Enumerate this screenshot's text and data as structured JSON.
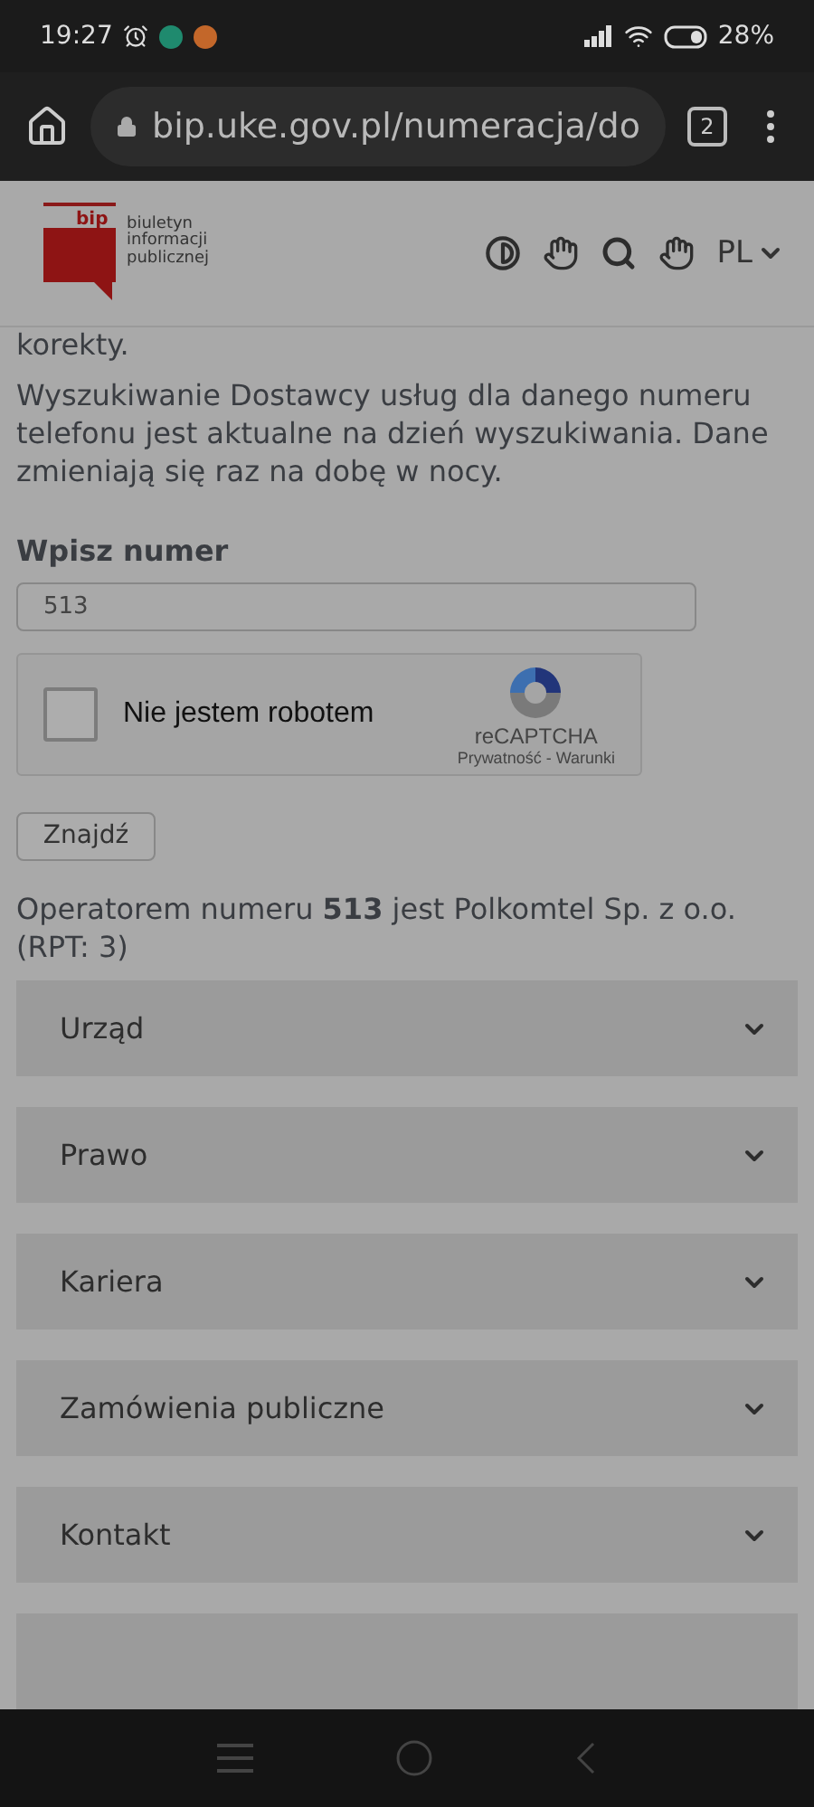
{
  "status_bar": {
    "time": "19:27",
    "battery": "28%"
  },
  "browser": {
    "url": "bip.uke.gov.pl/numeracja/do",
    "tab_count": "2"
  },
  "header": {
    "logo_text": "biuletyn informacji publicznej",
    "logo_mark": "bip",
    "language": "PL"
  },
  "content": {
    "cut_text": "korekty.",
    "intro": "Wyszukiwanie Dostawcy usług dla danego numeru telefonu jest aktualne na dzień wyszukiwania. Dane zmieniają się raz na dobę w nocy.",
    "field_label": "Wpisz numer",
    "field_value": "513",
    "captcha": {
      "label": "Nie jestem robotem",
      "checked": false,
      "brand": "reCAPTCHA",
      "links": "Prywatność - Warunki"
    },
    "button": "Znajdź",
    "result": "Operatorem numeru **513** jest Polkomtel Sp. z o.o. (RPT: 3)"
  },
  "menu": [
    {
      "label": "Urząd",
      "expanded": false
    },
    {
      "label": "Prawo",
      "expanded": false
    },
    {
      "label": "Kariera",
      "expanded": false
    },
    {
      "label": "Zamówienia publiczne",
      "expanded": false
    },
    {
      "label": "Kontakt",
      "expanded": false
    }
  ]
}
